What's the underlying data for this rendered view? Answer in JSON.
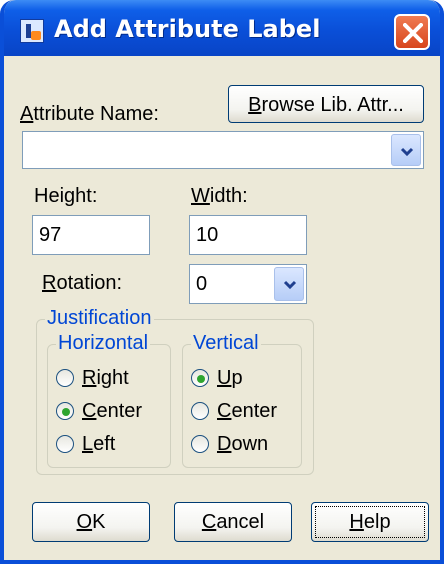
{
  "window": {
    "title": "Add Attribute Label",
    "icon": "jobs-app-icon"
  },
  "attribute": {
    "label_ul": "A",
    "label_rest": "ttribute Name:",
    "browse_ul": "B",
    "browse_rest": "rowse Lib. Attr...",
    "value": ""
  },
  "height": {
    "label": "Height:",
    "value": "97"
  },
  "width": {
    "label_ul": "W",
    "label_rest": "idth:",
    "value": "10"
  },
  "rotation": {
    "label_ul": "R",
    "label_rest": "otation:",
    "value": "0"
  },
  "justification": {
    "label": "Justification",
    "horizontal": {
      "label": "Horizontal",
      "options": [
        {
          "ul": "R",
          "rest": "ight",
          "selected": false
        },
        {
          "ul": "C",
          "rest": "enter",
          "selected": true
        },
        {
          "ul": "L",
          "rest": "eft",
          "selected": false
        }
      ]
    },
    "vertical": {
      "label": "Vertical",
      "options": [
        {
          "ul": "U",
          "rest": "p",
          "selected": true
        },
        {
          "ul": "C",
          "rest": "enter",
          "selected": false
        },
        {
          "ul": "D",
          "rest": "own",
          "selected": false
        }
      ]
    }
  },
  "buttons": {
    "ok_ul": "O",
    "ok_rest": "K",
    "cancel_ul": "C",
    "cancel_rest": "ancel",
    "help_ul": "H",
    "help_rest": "elp"
  },
  "colors": {
    "titlebar": "#0a4fd8",
    "group_label": "#0046d5",
    "radio_selected": "#2ea52f",
    "close": "#d8461c"
  }
}
